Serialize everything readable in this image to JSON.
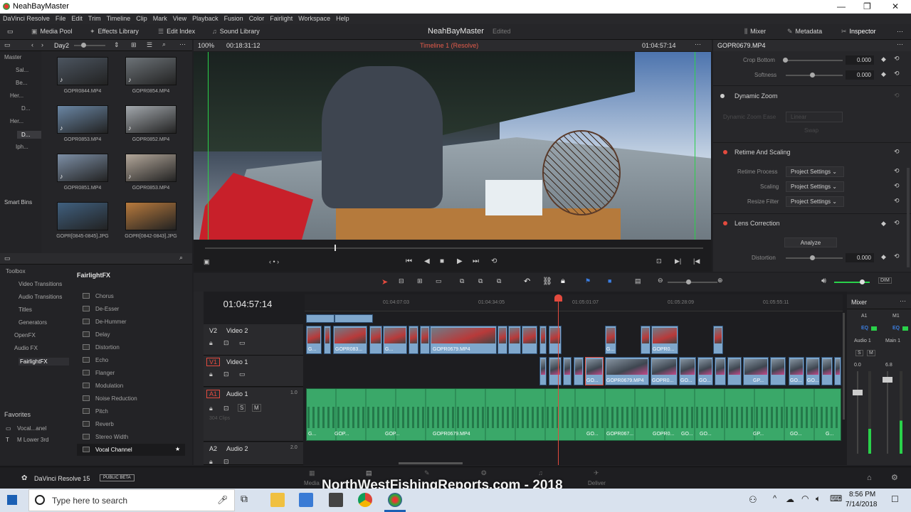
{
  "window": {
    "title": "NeahBayMaster",
    "min": "—",
    "max": "❐",
    "close": "✕"
  },
  "menu": [
    "DaVinci Resolve",
    "File",
    "Edit",
    "Trim",
    "Timeline",
    "Clip",
    "Mark",
    "View",
    "Playback",
    "Fusion",
    "Color",
    "Fairlight",
    "Workspace",
    "Help"
  ],
  "toolbar": {
    "media_pool": "Media Pool",
    "effects_library": "Effects Library",
    "edit_index": "Edit Index",
    "sound_library": "Sound Library",
    "project_name": "NeahBayMaster",
    "status": "Edited",
    "mixer": "Mixer",
    "metadata": "Metadata",
    "inspector": "Inspector"
  },
  "media_pool": {
    "bin_name": "Day2",
    "tree": [
      "Master",
      "Sal...",
      "Be...",
      "Her...",
      "D...",
      "Her...",
      "D...",
      "Iph..."
    ],
    "smart_bins": "Smart Bins",
    "clips": [
      {
        "name": "GOPR0844.MP4",
        "color": "#4c5560"
      },
      {
        "name": "GOPR0854.MP4",
        "color": "#6d7378"
      },
      {
        "name": "GOPR0853.MP4",
        "color": "#6a86a4"
      },
      {
        "name": "GOPR0852.MP4",
        "color": "#a3a8ad"
      },
      {
        "name": "GOPR0851.MP4",
        "color": "#7d8fa6"
      },
      {
        "name": "GOPR0853.MP4",
        "color": "#b3a79a"
      },
      {
        "name": "GOPR[0845-0845].JPG",
        "color": "#40607f"
      },
      {
        "name": "GOPR[0842-0843].JPG",
        "color": "#b87a3d"
      }
    ]
  },
  "effects": {
    "toolbox": "Toolbox",
    "tree": [
      "Video Transitions",
      "Audio Transitions",
      "Titles",
      "Generators",
      "OpenFX",
      "Audio FX",
      "FairlightFX"
    ],
    "header": "FairlightFX",
    "items": [
      "Chorus",
      "De-Esser",
      "De-Hummer",
      "Delay",
      "Distortion",
      "Echo",
      "Flanger",
      "Modulation",
      "Noise Reduction",
      "Pitch",
      "Reverb",
      "Stereo Width",
      "Vocal Channel"
    ],
    "favorites_title": "Favorites",
    "favorites": [
      "Vocal...anel",
      "M Lower 3rd"
    ]
  },
  "viewer": {
    "zoom": "100%",
    "duration": "00:18:31:12",
    "timeline_name": "Timeline 1 (Resolve)",
    "timecode": "01:04:57:14"
  },
  "inspector": {
    "clip_name": "GOPR0679.MP4",
    "crop_bottom": "Crop Bottom",
    "crop_bottom_val": "0.000",
    "softness": "Softness",
    "softness_val": "0.000",
    "dynamic_zoom": "Dynamic Zoom",
    "dz_ease": "Dynamic Zoom Ease",
    "dz_ease_val": "Linear",
    "swap": "Swap",
    "retime_scaling": "Retime And Scaling",
    "retime_process": "Retime Process",
    "scaling": "Scaling",
    "resize_filter": "Resize Filter",
    "project_settings": "Project Settings",
    "lens_correction": "Lens Correction",
    "analyze": "Analyze",
    "distortion": "Distortion",
    "distortion_val": "0.000"
  },
  "timeline": {
    "timecode": "01:04:57:14",
    "ruler": [
      "01:04:07:03",
      "01:04:34:05",
      "01:05:01:07",
      "01:05:28:09",
      "01:05:55:11"
    ],
    "tracks": [
      {
        "id": "V2",
        "name": "Video 2"
      },
      {
        "id": "V1",
        "name": "Video 1"
      },
      {
        "id": "A1",
        "name": "Audio 1",
        "ch": "1.0",
        "clips": "304 Clips"
      },
      {
        "id": "A2",
        "name": "Audio 2",
        "ch": "2.0"
      }
    ],
    "v2_labels": [
      "G...",
      "GOPR083...",
      "G...",
      "GOPR0679.MP4",
      "G...",
      "GOPR0..."
    ],
    "v1_labels": [
      "GO...",
      "GOPR0679.MP4",
      "GOPR0...",
      "GO...",
      "GO...",
      "GP...",
      "GO...",
      "GO..."
    ],
    "a1_labels": [
      "G...",
      "GOP...",
      "GOP...",
      "GOPR0679.MP4",
      "GO...",
      "GOPR067...",
      "GOPR0...",
      "GO...",
      "GO...",
      "GP...",
      "GO...",
      "G..."
    ]
  },
  "mixer": {
    "title": "Mixer",
    "a1": "A1",
    "m1": "M1",
    "eq": "EQ",
    "audio1": "Audio 1",
    "main1": "Main 1",
    "s": "S",
    "m": "M",
    "v1": "0.0",
    "v2": "6.8"
  },
  "pages": {
    "brand": "DaVinci Resolve 15",
    "beta": "PUBLIC BETA",
    "media": "Media",
    "deliver": "Deliver",
    "watermark": "NorthWestFishingReports.com - 2018"
  },
  "taskbar": {
    "search": "Type here to search",
    "time": "8:56 PM",
    "date": "7/14/2018"
  }
}
